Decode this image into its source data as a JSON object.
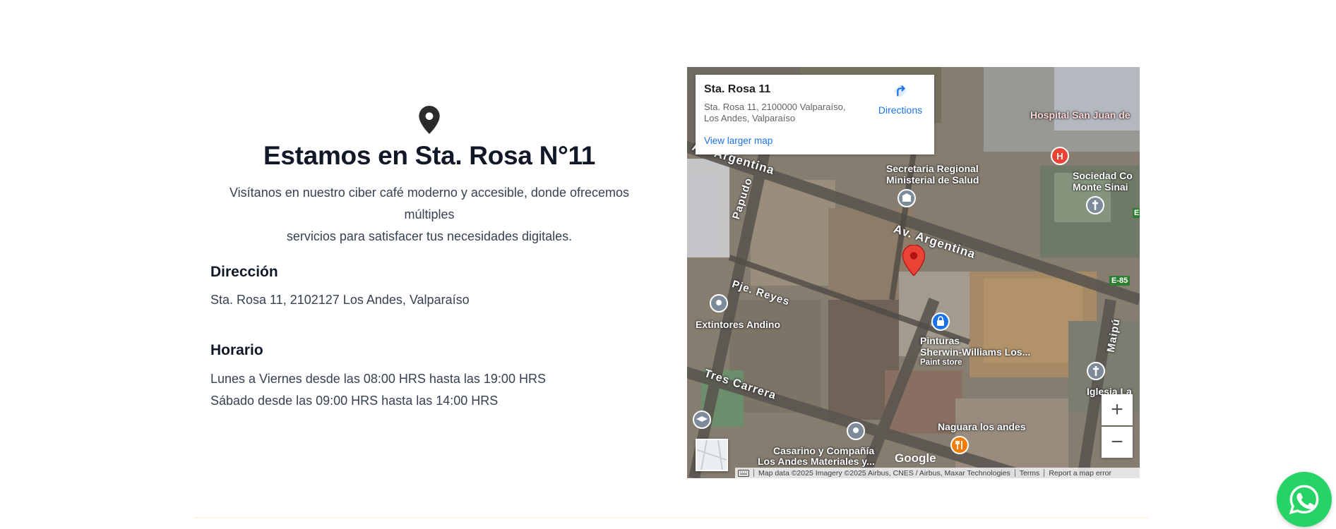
{
  "location": {
    "icon": "map-pin-icon",
    "title": "Estamos en Sta. Rosa N°11",
    "subtitle_line1": "Visítanos en nuestro ciber café moderno y accesible, donde ofrecemos múltiples",
    "subtitle_line2": "servicios para satisfacer tus necesidades digitales.",
    "address_heading": "Dirección",
    "address": "Sta. Rosa 11, 2102127 Los Andes, Valparaíso",
    "hours_heading": "Horario",
    "hours": [
      "Lunes a Viernes desde las 08:00 HRS hasta las 19:00 HRS",
      "Sábado desde las 09:00 HRS hasta las 14:00 HRS"
    ]
  },
  "map": {
    "place_name": "Sta. Rosa 11",
    "place_address": "Sta. Rosa 11, 2100000 Valparaíso, Los Andes, Valparaíso",
    "directions_label": "Directions",
    "larger_map_label": "View larger map",
    "zoom_in": "+",
    "zoom_out": "−",
    "google_logo": "Google",
    "attribution": "Map data ©2025 Imagery ©2025 Airbus, CNES / Airbus, Maxar Technologies",
    "terms": "Terms",
    "report": "Report a map error",
    "labels": {
      "hospital": "Hospital San Juan de",
      "seremi_1": "Secretaria Regional",
      "seremi_2": "Ministerial de Salud",
      "sociedad_1": "Sociedad Co",
      "sociedad_2": "Monte Sinai",
      "av_argentina_1": "Av. Argentina",
      "av_argentina_2": "Av. Argentina",
      "papudo": "Papudo",
      "pje_reyes": "Pje. Reyes",
      "extintores": "Extintores Andino",
      "pinturas_1": "Pinturas",
      "pinturas_2": "Sherwin-Williams Los...",
      "pinturas_3": "Paint store",
      "tres_carrera": "Tres Carrera",
      "maipu": "Maipú",
      "iglesia": "Iglesia La",
      "naguara": "Naguara los andes",
      "casarino_1": "Casarino y Compañía",
      "casarino_2": "Los Andes Materiales y...",
      "e85": "E-85",
      "e_short": "E"
    }
  },
  "colors": {
    "heading": "#111827",
    "body": "#374151",
    "link": "#1a73e8",
    "pin": "#ea4335",
    "whatsapp": "#25d366"
  },
  "floating": {
    "icon": "whatsapp-icon"
  }
}
